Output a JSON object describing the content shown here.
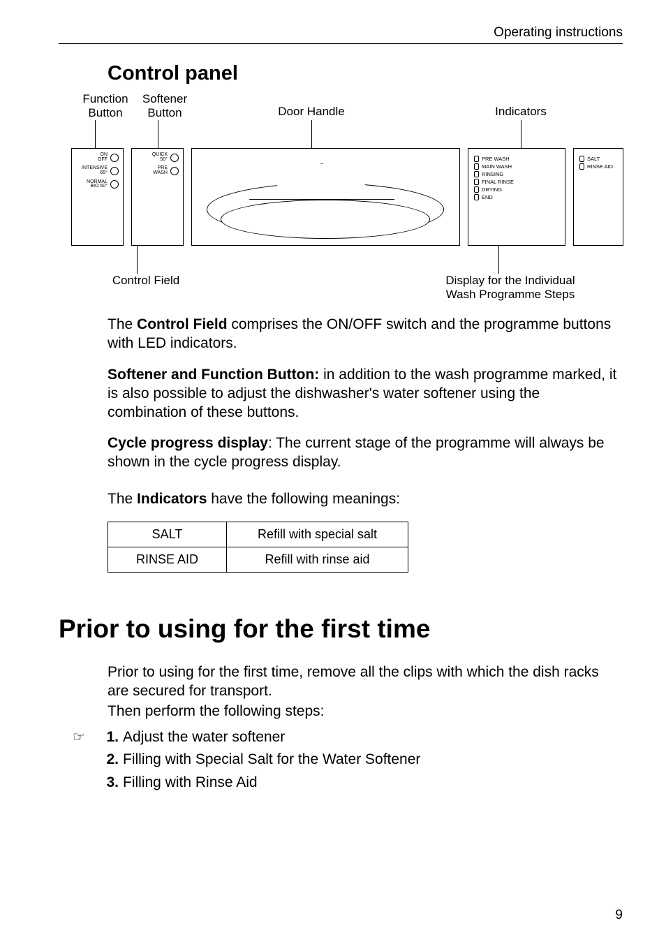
{
  "running_header": "Operating instructions",
  "section_title": "Control panel",
  "diagram": {
    "labels": {
      "function": "Function\nButton",
      "softener": "Softener\nButton",
      "door": "Door Handle",
      "indicators": "Indicators",
      "control_field": "Control Field",
      "display_prog": "Display for the Individual\nWash Programme Steps"
    },
    "buttons_left": [
      {
        "top": "ON",
        "bottom": "OFF"
      },
      {
        "top": "INTENSIVE",
        "bottom": "65°"
      },
      {
        "top": "NORMAL",
        "bottom": "BIO 50°"
      }
    ],
    "buttons_left2": [
      {
        "top": "QUICK",
        "bottom": "50°"
      },
      {
        "top": "PRE",
        "bottom": "WASH"
      }
    ],
    "progress_rows": [
      "PRE WASH",
      "MAIN WASH",
      "RINSING",
      "FINAL RINSE",
      "DRYING",
      "END"
    ],
    "indicator_rows": [
      "SALT",
      "RINSE AID"
    ]
  },
  "para1_prefix": "The ",
  "para1_bold": "Control Field",
  "para1_rest": " comprises the ON/OFF switch and the programme buttons with LED indicators.",
  "para2_bold": "Softener and Function Button:",
  "para2_rest": " in addition to the wash programme marked, it is also possible to adjust the dishwasher's water softener using the combination of these buttons.",
  "para3_bold": "Cycle progress display",
  "para3_rest": ": The current stage of the programme will always be shown in the cycle progress display.",
  "para4_prefix": "The ",
  "para4_bold": "Indicators",
  "para4_rest": " have the following meanings:",
  "ind_table": [
    {
      "label": "SALT",
      "meaning": "Refill with special salt"
    },
    {
      "label": "RINSE AID",
      "meaning": "Refill with rinse aid"
    }
  ],
  "prior_title": "Prior to using for the first time",
  "prior_intro1": "Prior to using for the first time, remove all the clips with which the dish racks are secured for transport.",
  "prior_intro2": "Then perform the following steps:",
  "hand_icon": "☞",
  "steps": [
    {
      "n": "1.",
      "text": "Adjust the water softener",
      "icon": true
    },
    {
      "n": "2.",
      "text": "Filling with Special Salt for the Water Softener",
      "icon": false
    },
    {
      "n": "3.",
      "text": "Filling with Rinse Aid",
      "icon": false
    }
  ],
  "page_number": "9"
}
